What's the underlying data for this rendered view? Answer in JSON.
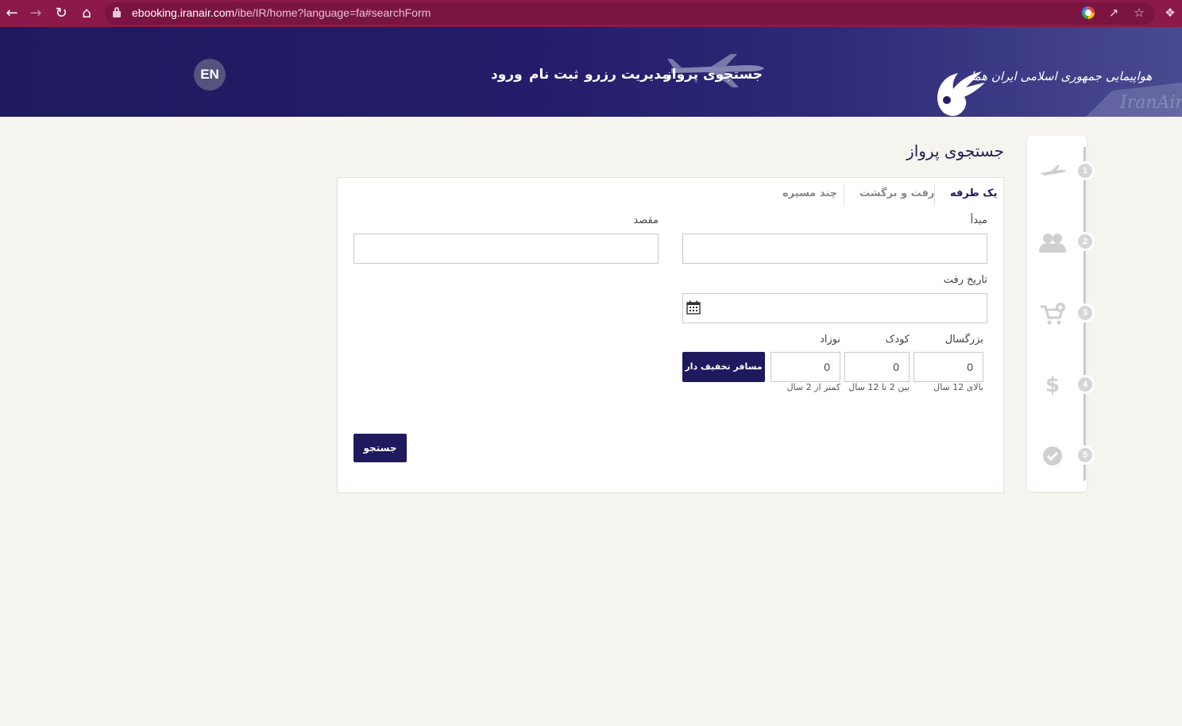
{
  "browser": {
    "url_host": "ebooking.iranair.com",
    "url_path": "/ibe/IR/home?language=fa#searchForm"
  },
  "header": {
    "logo_text": "هواپیمایی جمهوری اسلامی ایران هما",
    "nav": {
      "flight_search": "جستجوی پرواز",
      "manage_booking": "مدیریت رزرو",
      "register": "ثبت نام",
      "login": "ورود"
    },
    "lang_button": "EN"
  },
  "steps": [
    {
      "number": "1",
      "icon": "airplane-icon"
    },
    {
      "number": "2",
      "icon": "passengers-icon"
    },
    {
      "number": "3",
      "icon": "add-to-cart-icon"
    },
    {
      "number": "4",
      "icon": "dollar-icon"
    },
    {
      "number": "5",
      "icon": "check-circle-icon"
    }
  ],
  "main": {
    "title": "جستجوی پرواز",
    "tabs": {
      "one_way": "یک طرفه",
      "round_trip": "رفت و برگشت",
      "multi_city": "چند مسیره"
    },
    "origin_label": "مبدأ",
    "destination_label": "مقصد",
    "departure_date_label": "تاریخ رفت",
    "passengers": {
      "adult_label": "بزرگسال",
      "adult_value": "0",
      "adult_hint": "بالای 12 سال",
      "child_label": "کودک",
      "child_value": "0",
      "child_hint": "بین 2 تا 12 سال",
      "infant_label": "نوزاد",
      "infant_value": "0",
      "infant_hint": "کمتر از 2 سال"
    },
    "discount_button": "مسافر تخفیف دار",
    "search_button": "جستجو"
  },
  "colors": {
    "brand_navy": "#1f1a5e",
    "browser_bar": "#8b1a4a",
    "page_bg": "#f6f4ef"
  }
}
